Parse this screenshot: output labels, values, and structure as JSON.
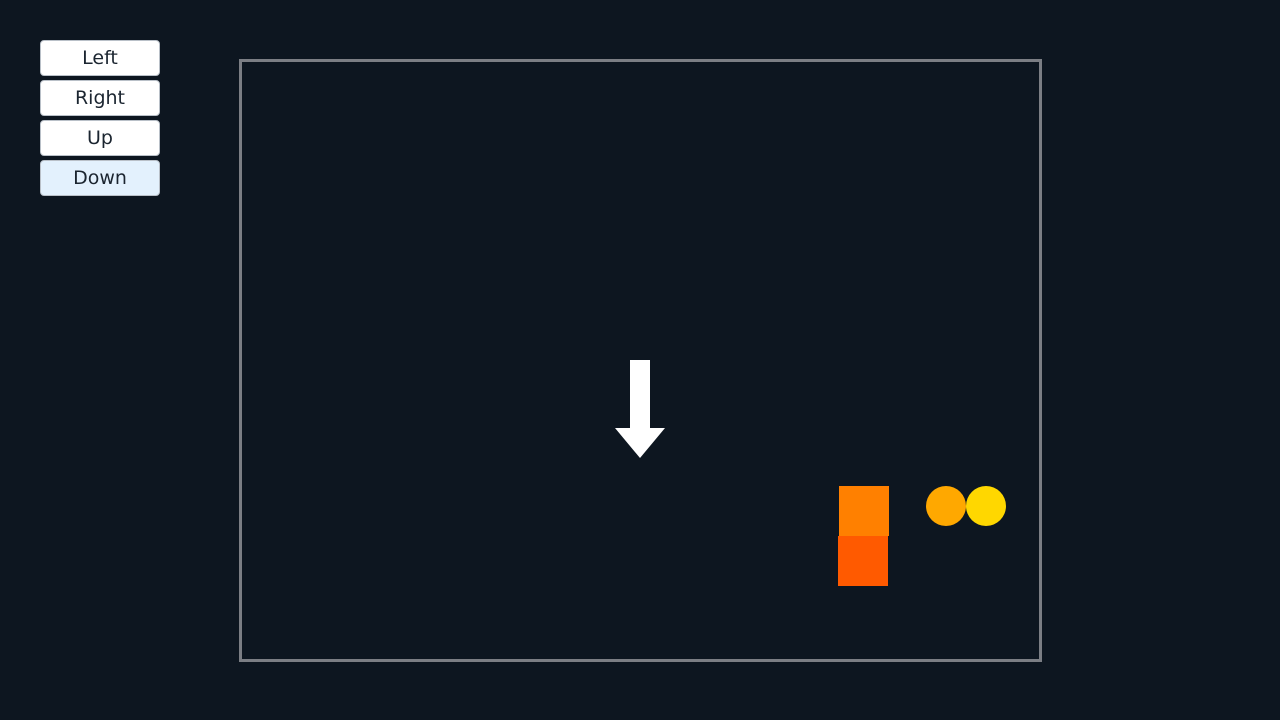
{
  "controls": {
    "left_label": "Left",
    "right_label": "Right",
    "up_label": "Up",
    "down_label": "Down",
    "active": "Down"
  },
  "game": {
    "direction_indicator": "arrow-down-icon",
    "colors": {
      "background": "#0d1620",
      "border": "#7b7e84",
      "arrow": "#ffffff",
      "square_top": "#ff8000",
      "square_bottom": "#ff5a00",
      "circle_left": "#ffa800",
      "circle_right": "#ffd700"
    }
  }
}
